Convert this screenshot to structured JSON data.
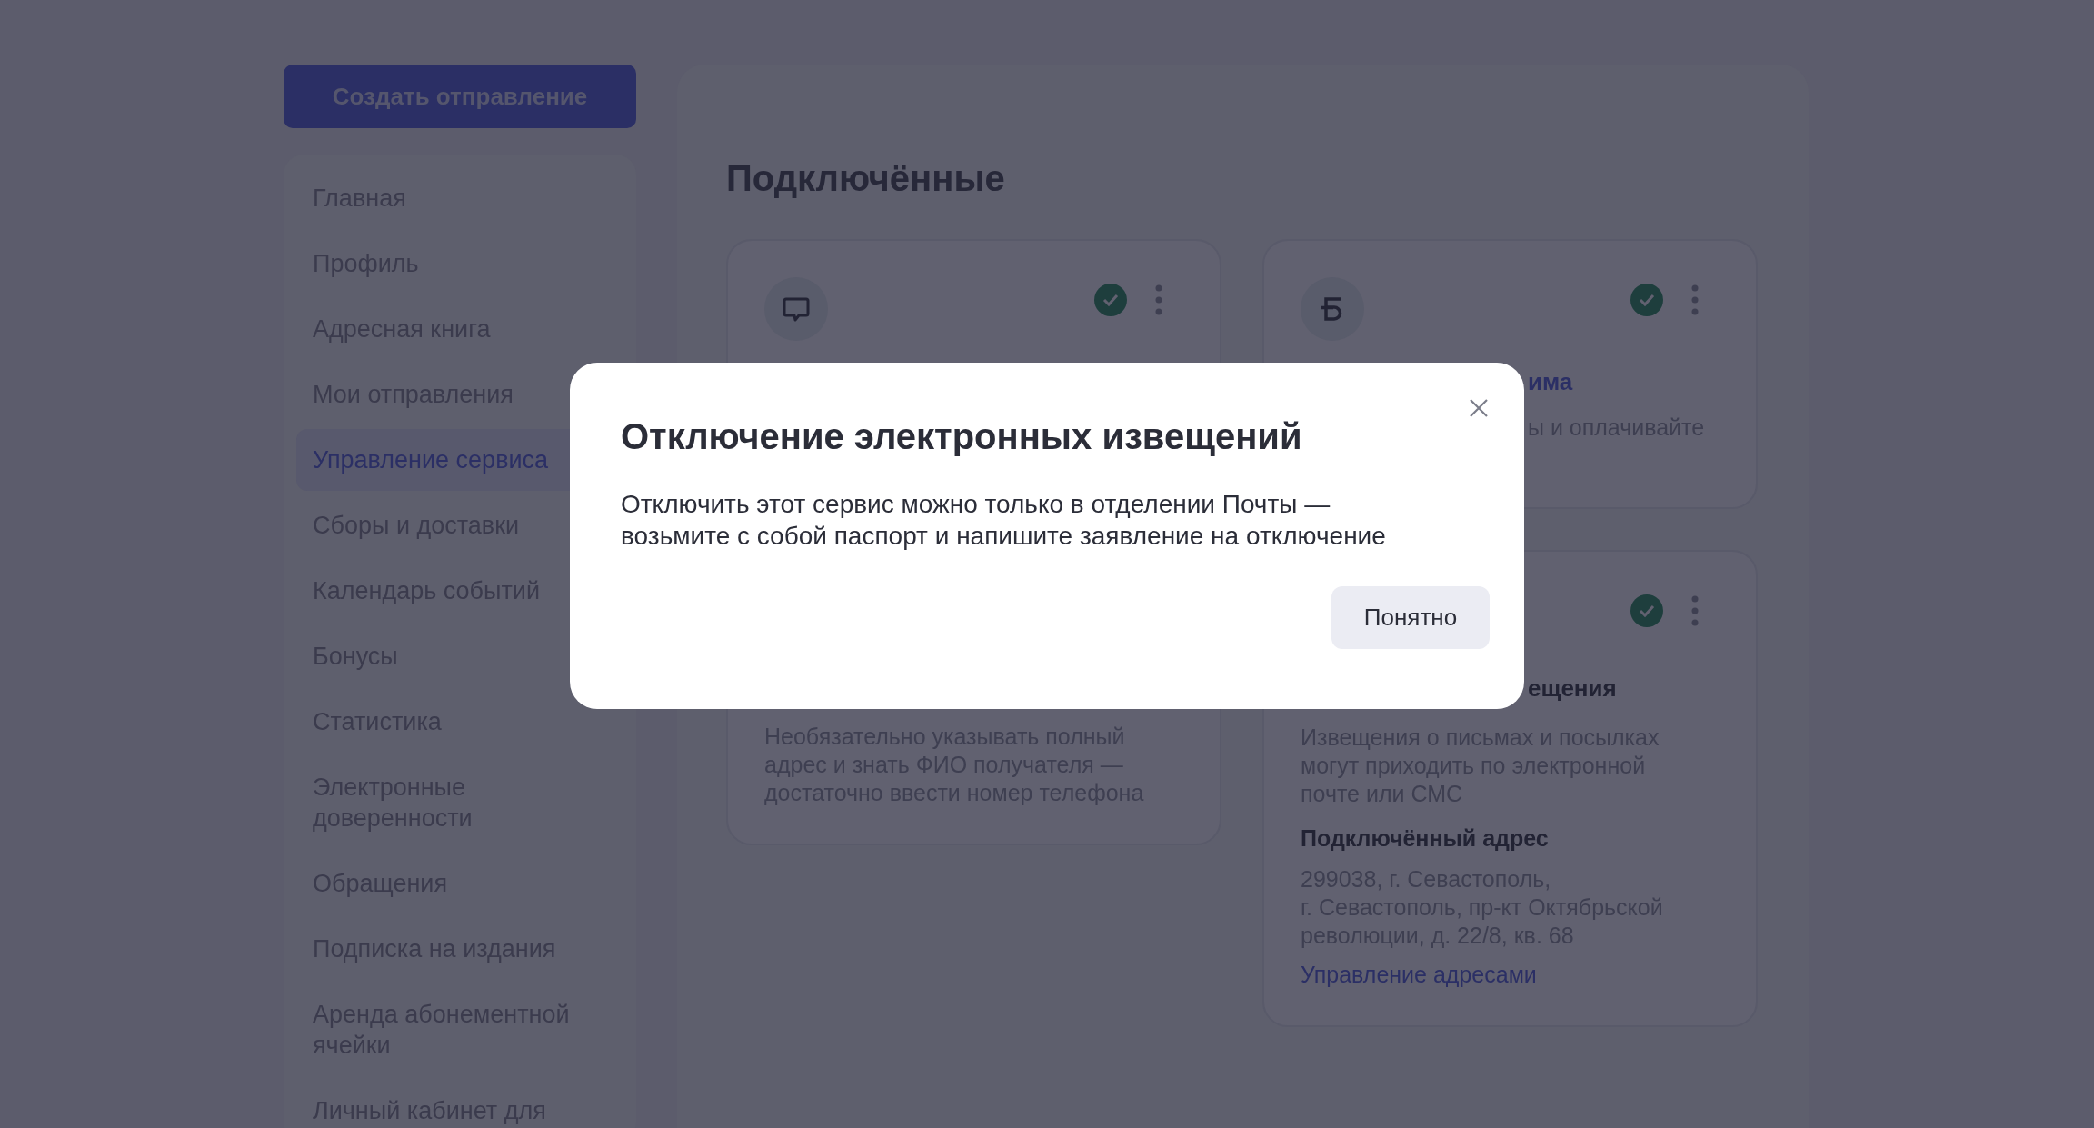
{
  "create_button": "Создать отправление",
  "sidebar": {
    "items": [
      {
        "label": "Главная",
        "selected": false
      },
      {
        "label": "Профиль",
        "selected": false
      },
      {
        "label": "Адресная книга",
        "selected": false
      },
      {
        "label": "Мои отправления",
        "selected": false
      },
      {
        "label": "Управление сервиса",
        "selected": true
      },
      {
        "label": "Сборы и доставки",
        "selected": false
      },
      {
        "label": "Календарь событий",
        "selected": false
      },
      {
        "label": "Бонусы",
        "selected": false
      },
      {
        "label": "Статистика",
        "selected": false
      },
      {
        "label": "Электронные\nдоверенности",
        "selected": false
      },
      {
        "label": "Обращения",
        "selected": false
      },
      {
        "label": "Подписка на издания",
        "selected": false
      },
      {
        "label": "Аренда абонементной\nячейки",
        "selected": false
      },
      {
        "label": "Личный кабинет для",
        "selected": false
      }
    ]
  },
  "main": {
    "title": "Подключённые",
    "cards": [
      {
        "connected": true,
        "description": "Необязательно указывать полный\nадрес и знать ФИО получателя —\nдостаточно ввести номер телефона"
      },
      {
        "connected": true,
        "title": "има",
        "description": "ы и оплачивайте"
      },
      {
        "connected": true,
        "title": "ещения",
        "description": "Извещения о письмах и посылках\nмогут приходить по электронной\nпочте или СМС",
        "address_label": "Подключённый адрес",
        "address": "299038, г. Севастополь,\nг. Севастополь, пр-кт Октябрьской\nреволюции, д. 22/8, кв. 68",
        "link": "Управление адресами"
      }
    ]
  },
  "modal": {
    "title": "Отключение электронных извещений",
    "text": "Отключить этот сервис можно только в отделении Почты —\nвозьмите с собой паспорт и напишите заявление на отключение",
    "button": "Понятно"
  }
}
